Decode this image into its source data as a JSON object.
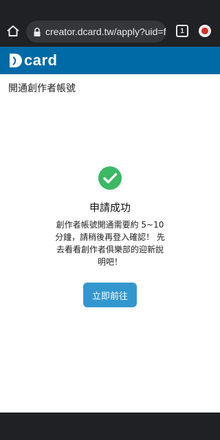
{
  "browser": {
    "url": "creator.dcard.tw/apply?uid=f",
    "tab_count": "1",
    "icons": {
      "home": "home-icon",
      "lock": "lock-icon",
      "tabs": "tab-switcher-icon",
      "profile": "profile-icon"
    }
  },
  "header": {
    "logo_text": "card",
    "brand_color": "#006aa6"
  },
  "page": {
    "title": "開通創作者帳號"
  },
  "result": {
    "heading": "申請成功",
    "message": "創作者帳號開通需要約 5~10 分鐘，請稍後再登入確認！ 先去看看創作者俱樂部的迎新說明吧！",
    "icon": "check-circle-icon",
    "icon_color": "#3cb964"
  },
  "actions": {
    "go_button": "立即前往",
    "button_color": "#3397cf"
  }
}
